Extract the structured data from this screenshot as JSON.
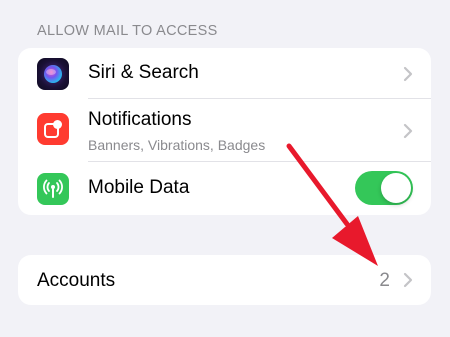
{
  "section": {
    "header": "ALLOW MAIL TO ACCESS"
  },
  "rows": [
    {
      "label": "Siri & Search",
      "icon": "siri-icon"
    },
    {
      "label": "Notifications",
      "subtitle": "Banners, Vibrations, Badges",
      "icon": "notifications-icon"
    },
    {
      "label": "Mobile Data",
      "icon": "mobile-data-icon",
      "toggle_on": true
    }
  ],
  "accounts": {
    "label": "Accounts",
    "value": "2"
  },
  "colors": {
    "background": "#f2f2f7",
    "toggle_on": "#34c759",
    "notifications_icon": "#ff3b30",
    "mobile_data_icon": "#34c759",
    "annotation_arrow": "#e8192c"
  }
}
